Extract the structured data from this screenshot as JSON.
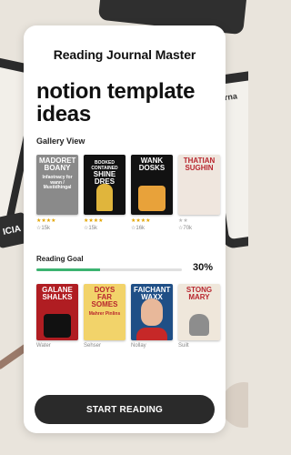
{
  "app": {
    "title": "Reading Journal Master",
    "headline": "notion template ideas"
  },
  "background": {
    "right_tablet_text": "Jorna",
    "left_label": "ICIA"
  },
  "gallery": {
    "label": "Gallery View",
    "books": [
      {
        "title": "MADORET BOANY",
        "subtitle": "Infaotnacy for wann / Mustidhingal",
        "stars": "★★★★",
        "count": "☆15k"
      },
      {
        "title": "SHINE DRES",
        "subtitle": "BOOKED CONTAINED",
        "stars": "★★★★",
        "count": "☆15k"
      },
      {
        "title": "WANK DOSKS",
        "subtitle": "",
        "stars": "★★★★",
        "count": "☆16k"
      },
      {
        "title": "THATIAN SUGHIN",
        "subtitle": "",
        "stars": "★★",
        "count": "☆70k"
      }
    ]
  },
  "goal": {
    "label": "Reading Goal",
    "progress": 0.44,
    "percent_label": "30%"
  },
  "row2": {
    "books": [
      {
        "title": "GALANE SHALKS",
        "caption": "Water"
      },
      {
        "title": "DOYS FAR SOMES",
        "subtitle": "Mahrer Pinlins",
        "caption": "Sehser"
      },
      {
        "title": "FAICHANT WAXX",
        "caption": "Nollay"
      },
      {
        "title": "STONG MARY",
        "caption": "Suilt"
      }
    ]
  },
  "cta": {
    "label": "START READING"
  },
  "colors": {
    "accent": "#3cb371",
    "button": "#2a2a2a",
    "star": "#e2a400"
  }
}
